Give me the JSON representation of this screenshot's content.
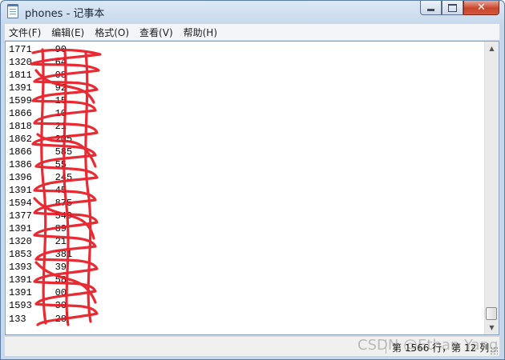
{
  "window": {
    "title": "phones - 记事本"
  },
  "menu": {
    "items": [
      "文件(F)",
      "编辑(E)",
      "格式(O)",
      "查看(V)",
      "帮助(H)"
    ]
  },
  "editor": {
    "lines": [
      "1771    90",
      "1320    64",
      "1811    08",
      "1391    92",
      "1599    15",
      "1866    10",
      "1818    21",
      "1862    205",
      "1866    585",
      "1386    55",
      "1396    245",
      "1391    45",
      "1594    875",
      "1377    549",
      "1391    89",
      "1320    21",
      "1853    381",
      "1393    39",
      "1391    58",
      "1391    00",
      "1593    30",
      "133     28"
    ],
    "redaction_color": "#e8141e"
  },
  "status": {
    "position": "第 1566 行，第 12 列",
    "watermark": "CSDN @Ethan Yang"
  },
  "colors": {
    "title_bar": "#c7d8ec",
    "close_button": "#c8452b"
  }
}
